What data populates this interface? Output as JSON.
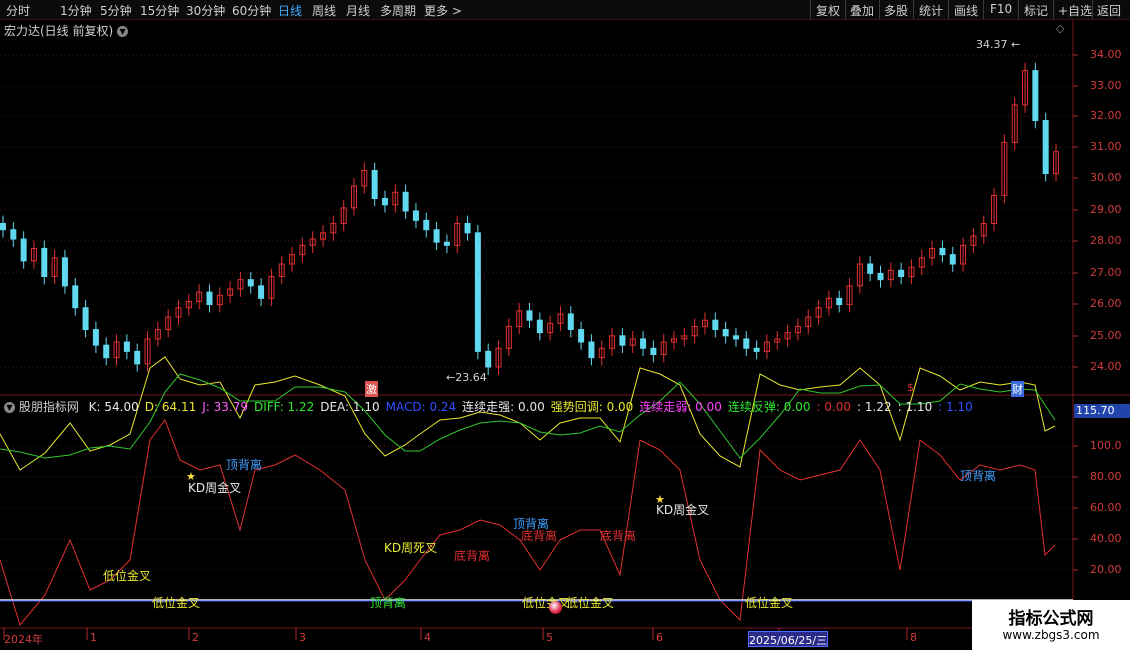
{
  "toolbar": {
    "left": [
      "分时",
      "1分钟",
      "5分钟",
      "15分钟",
      "30分钟",
      "60分钟",
      "日线",
      "周线",
      "月线",
      "多周期",
      "更多 >"
    ],
    "active": "日线",
    "right": [
      "复权",
      "叠加",
      "多股",
      "统计",
      "画线",
      "F10",
      "标记",
      "+自选",
      "返回"
    ]
  },
  "main_header": {
    "title": "宏力达(日线 前复权)",
    "icon": "chevron-down-icon"
  },
  "diamond_icon": "diamond-icon",
  "price_axis": [
    "34.00",
    "33.00",
    "32.00",
    "31.00",
    "30.00",
    "29.00",
    "28.00",
    "27.00",
    "26.00",
    "25.00",
    "24.00"
  ],
  "price_annotations": {
    "high": "34.37",
    "low": "23.64"
  },
  "event_markers": [
    {
      "text": "激",
      "color": "#d9534f"
    },
    {
      "text": "$",
      "color": "#e03030"
    },
    {
      "text": "财",
      "color": "#3a6ad9"
    }
  ],
  "indicator_header": {
    "title": "股朋指标网",
    "items": [
      {
        "label": "K: 54.00",
        "color": "#e8e8e8"
      },
      {
        "label": "D: 64.11",
        "color": "#e8e830"
      },
      {
        "label": "J: 33.79",
        "color": "#ff60ff"
      },
      {
        "label": "DIFF: 1.22",
        "color": "#30e830"
      },
      {
        "label": "DEA: 1.10",
        "color": "#e8e8e8"
      },
      {
        "label": "MACD: 0.24",
        "color": "#3050ff"
      },
      {
        "label": "连续走强: 0.00",
        "color": "#e8e8e8"
      },
      {
        "label": "强势回调: 0.00",
        "color": "#e8e830"
      },
      {
        "label": "连续走弱: 0.00",
        "color": "#ff40ff"
      },
      {
        "label": "连续反弹: 0.00",
        "color": "#30e830"
      },
      {
        "label": ": 0.00",
        "color": "#e03030"
      },
      {
        "label": ": 1.22",
        "color": "#e8e8e8"
      },
      {
        "label": ": 1.10",
        "color": "#e8e8e8"
      },
      {
        "label": ": 1.10",
        "color": "#3050ff"
      }
    ]
  },
  "indicator_axis_top": "115.70",
  "indicator_axis": [
    "100.0",
    "80.00",
    "60.00",
    "40.00",
    "20.00"
  ],
  "annotations": [
    {
      "text": "顶背离",
      "color": "#40a0ff"
    },
    {
      "text": "KD周金叉",
      "color": "#e8e8e8"
    },
    {
      "text": "低位金叉",
      "color": "#e8e830"
    },
    {
      "text": "低位金叉",
      "color": "#e8e830"
    },
    {
      "text": "KD周死叉",
      "color": "#e8e830"
    },
    {
      "text": "底背离",
      "color": "#e03030"
    },
    {
      "text": "顶背离",
      "color": "#30e830"
    },
    {
      "text": "顶背离",
      "color": "#40a0ff"
    },
    {
      "text": "底背离",
      "color": "#e03030"
    },
    {
      "text": "低位金叉",
      "color": "#e8e830"
    },
    {
      "text": "低位金叉",
      "color": "#e8e830"
    },
    {
      "text": "底背离",
      "color": "#e03030"
    },
    {
      "text": "KD周金叉",
      "color": "#e8e8e8"
    },
    {
      "text": "低位金叉",
      "color": "#e8e830"
    },
    {
      "text": "顶背离",
      "color": "#40a0ff"
    }
  ],
  "date_axis": [
    "2024年",
    "1",
    "2",
    "3",
    "4",
    "5",
    "6",
    "7",
    "8"
  ],
  "date_highlight": "2025/06/25/三",
  "watermark": {
    "line1": "指标公式网",
    "line2": "www.zbgs3.com"
  }
}
